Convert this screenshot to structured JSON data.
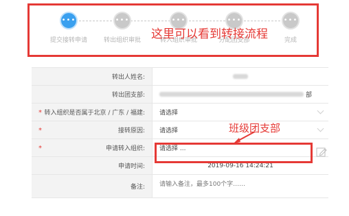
{
  "steps": [
    {
      "label": "提交接转申请",
      "icon": "more-icon",
      "active": true
    },
    {
      "label": "转出组织审批",
      "icon": "more-icon",
      "active": false
    },
    {
      "label": "转入组织审批",
      "icon": "more-icon",
      "active": false
    },
    {
      "label": "分配团支部",
      "icon": "more-icon",
      "active": false
    },
    {
      "label": "完成",
      "icon": "more-icon",
      "active": false
    }
  ],
  "step_dot_text": "•••",
  "annotations": {
    "flow_note": "这里可以看到转接流程",
    "branch_note": "班级团支部"
  },
  "form": {
    "rows": [
      {
        "label": "转出人姓名:",
        "value": "",
        "required": false
      },
      {
        "label": "转出团支部:",
        "value": "",
        "suffix": "部",
        "required": false
      },
      {
        "label": "转入组织是否属于北京 / 广东 / 福建:",
        "value": "请选择",
        "required": true
      },
      {
        "label": "接转原因:",
        "value": "请选择",
        "required": true
      },
      {
        "label": "申请转入组织:",
        "value": "请选择 ...",
        "required": true
      },
      {
        "label": "申请时间:",
        "value": "2019-09-16 14:24:21",
        "required": false
      },
      {
        "label": "备注:",
        "value": "请输入备注，最多100个字……",
        "required": false
      }
    ],
    "required_mark": "*"
  },
  "colors": {
    "accent": "#3aa0ef",
    "highlight": "#e53935",
    "inactive": "#c9c9c9"
  }
}
